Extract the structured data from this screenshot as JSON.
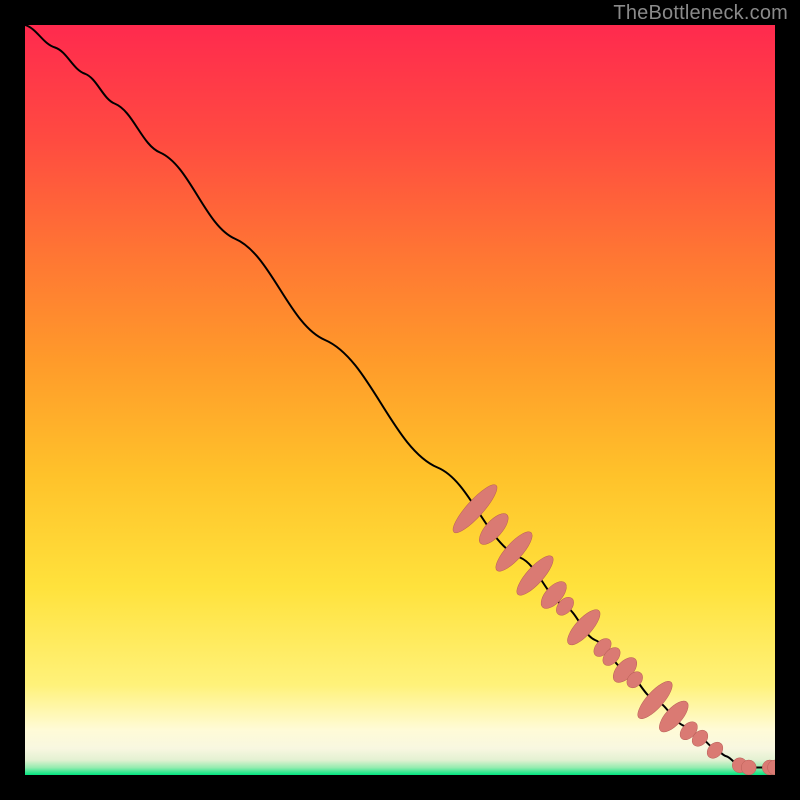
{
  "attribution": "TheBottleneck.com",
  "colors": {
    "line": "#000000",
    "marker_fill": "#da7a73",
    "marker_stroke": "#b95e57",
    "bg_black": "#000000"
  },
  "chart_data": {
    "type": "line",
    "title": "",
    "xlabel": "",
    "ylabel": "",
    "xlim": [
      0,
      100
    ],
    "ylim": [
      0,
      100
    ],
    "grid": false,
    "axes_visible": false,
    "gradient_stops": [
      {
        "offset": 0.0,
        "color": "#00e57f"
      },
      {
        "offset": 0.01,
        "color": "#96ecb0"
      },
      {
        "offset": 0.02,
        "color": "#e3f1d2"
      },
      {
        "offset": 0.035,
        "color": "#f8f7e0"
      },
      {
        "offset": 0.06,
        "color": "#fffbd7"
      },
      {
        "offset": 0.12,
        "color": "#fff27a"
      },
      {
        "offset": 0.25,
        "color": "#ffe23c"
      },
      {
        "offset": 0.4,
        "color": "#ffc22a"
      },
      {
        "offset": 0.55,
        "color": "#ff9b2a"
      },
      {
        "offset": 0.7,
        "color": "#ff7434"
      },
      {
        "offset": 0.85,
        "color": "#ff4a41"
      },
      {
        "offset": 1.0,
        "color": "#ff2a4e"
      }
    ],
    "series": [
      {
        "name": "curve",
        "x": [
          0,
          4,
          8,
          12,
          18,
          28,
          40,
          55,
          66,
          72,
          76,
          80,
          84,
          88,
          90,
          92,
          93.5,
          95,
          97,
          100
        ],
        "y": [
          100,
          97,
          93.5,
          89.5,
          83,
          71.5,
          58,
          41,
          29,
          22.5,
          18,
          14,
          10,
          6.5,
          5,
          3.5,
          2.5,
          1.5,
          1,
          1
        ]
      }
    ],
    "markers": [
      {
        "x": 60.0,
        "y": 35.5,
        "rx": 1.1,
        "ry": 4.2,
        "rot": 42
      },
      {
        "x": 62.5,
        "y": 32.8,
        "rx": 1.1,
        "ry": 2.6,
        "rot": 42
      },
      {
        "x": 65.2,
        "y": 29.8,
        "rx": 1.1,
        "ry": 3.4,
        "rot": 42
      },
      {
        "x": 68.0,
        "y": 26.6,
        "rx": 1.1,
        "ry": 3.4,
        "rot": 42
      },
      {
        "x": 70.5,
        "y": 24.0,
        "rx": 1.1,
        "ry": 2.2,
        "rot": 42
      },
      {
        "x": 72.0,
        "y": 22.5,
        "rx": 0.9,
        "ry": 1.4,
        "rot": 42
      },
      {
        "x": 74.5,
        "y": 19.7,
        "rx": 1.1,
        "ry": 3.0,
        "rot": 42
      },
      {
        "x": 77.0,
        "y": 17.0,
        "rx": 0.9,
        "ry": 1.4,
        "rot": 42
      },
      {
        "x": 78.2,
        "y": 15.8,
        "rx": 0.9,
        "ry": 1.4,
        "rot": 42
      },
      {
        "x": 80.0,
        "y": 14.0,
        "rx": 1.1,
        "ry": 2.0,
        "rot": 42
      },
      {
        "x": 81.3,
        "y": 12.7,
        "rx": 0.9,
        "ry": 1.2,
        "rot": 42
      },
      {
        "x": 84.0,
        "y": 10.0,
        "rx": 1.1,
        "ry": 3.2,
        "rot": 42
      },
      {
        "x": 86.5,
        "y": 7.8,
        "rx": 1.1,
        "ry": 2.6,
        "rot": 42
      },
      {
        "x": 88.5,
        "y": 5.9,
        "rx": 0.9,
        "ry": 1.4,
        "rot": 42
      },
      {
        "x": 90.0,
        "y": 4.9,
        "rx": 0.9,
        "ry": 1.2,
        "rot": 42
      },
      {
        "x": 92.0,
        "y": 3.3,
        "rx": 0.9,
        "ry": 1.2,
        "rot": 42
      },
      {
        "x": 95.3,
        "y": 1.3,
        "rx": 1.0,
        "ry": 1.0,
        "rot": 0
      },
      {
        "x": 96.5,
        "y": 1.0,
        "rx": 1.0,
        "ry": 1.0,
        "rot": 0
      },
      {
        "x": 99.3,
        "y": 1.0,
        "rx": 1.0,
        "ry": 1.0,
        "rot": 0
      },
      {
        "x": 100.0,
        "y": 1.0,
        "rx": 1.0,
        "ry": 1.0,
        "rot": 0
      }
    ]
  }
}
